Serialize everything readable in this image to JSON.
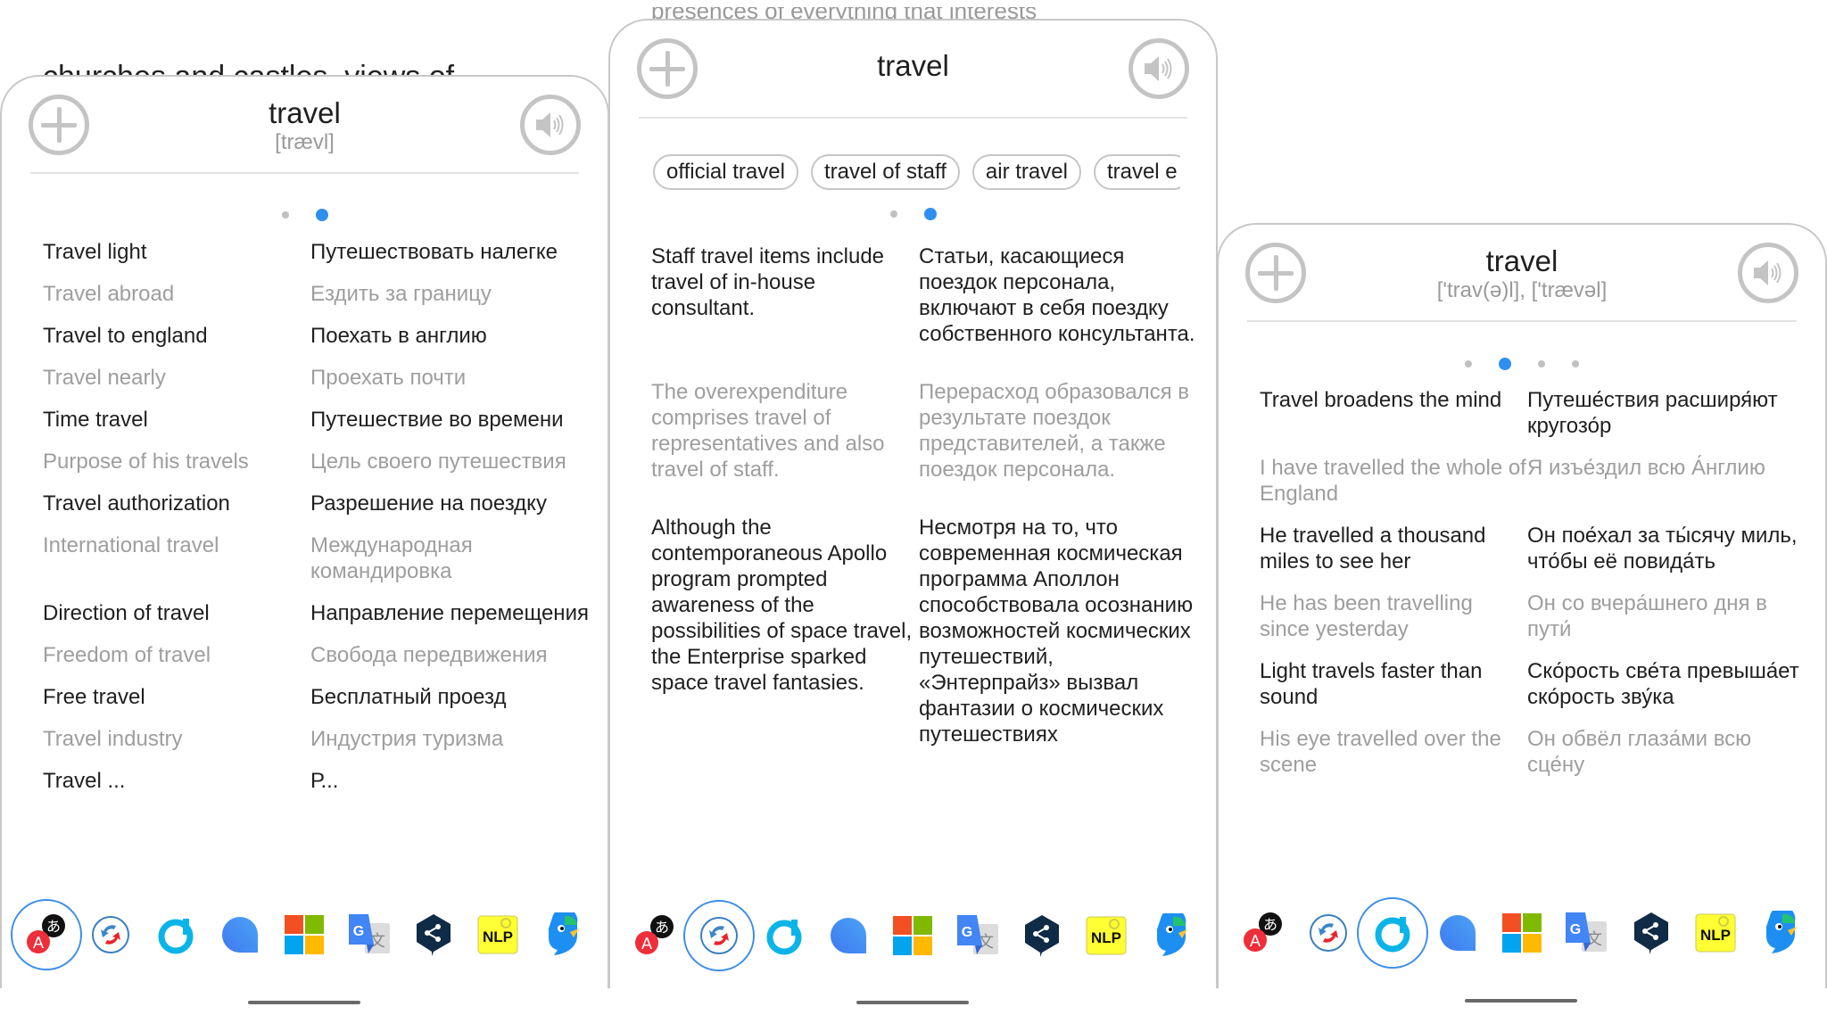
{
  "background_text": {
    "left": "churches and castles, views of",
    "middle": "presences of everything that interests"
  },
  "icons": {
    "add": "plus-circle-icon",
    "sound": "speaker-icon"
  },
  "translator_apps": [
    {
      "name": "translate-a-icon",
      "label": "Translate"
    },
    {
      "name": "reverso-icon",
      "label": "Reverso"
    },
    {
      "name": "dict-d-icon",
      "label": "Dictionary"
    },
    {
      "name": "blue-bubble-icon",
      "label": "Bubble"
    },
    {
      "name": "microsoft-icon",
      "label": "Microsoft Translator"
    },
    {
      "name": "google-translate-icon",
      "label": "Google Translate"
    },
    {
      "name": "deepl-icon",
      "label": "DeepL"
    },
    {
      "name": "nlp-icon",
      "label": "NLP"
    },
    {
      "name": "papago-icon",
      "label": "Papago"
    }
  ],
  "accent_color": "#2f8ff0",
  "panels": [
    {
      "word": "travel",
      "phonetic": "[trævl]",
      "page_count": 2,
      "active_page": 2,
      "selected_app": 1,
      "rows": [
        {
          "en": "Travel light",
          "ru": "Путешествовать налегке",
          "style": "dark"
        },
        {
          "en": "Travel abroad",
          "ru": "Ездить за границу",
          "style": "muted"
        },
        {
          "en": "Travel to england",
          "ru": "Поехать в англию",
          "style": "dark"
        },
        {
          "en": "Travel nearly",
          "ru": "Проехать почти",
          "style": "muted"
        },
        {
          "en": "Time travel",
          "ru": "Путешествие во времени",
          "style": "dark"
        },
        {
          "en": "Purpose of his travels",
          "ru": "Цель своего путешествия",
          "style": "muted"
        },
        {
          "en": "Travel authorization",
          "ru": "Разрешение на поездку",
          "style": "dark"
        },
        {
          "en": "International travel",
          "ru": "Международная командировка",
          "style": "muted"
        },
        {
          "en": "Direction of travel",
          "ru": "Направление перемещения",
          "style": "dark"
        },
        {
          "en": "Freedom of travel",
          "ru": "Свобода передвижения",
          "style": "muted"
        },
        {
          "en": "Free travel",
          "ru": "Бесплатный проезд",
          "style": "dark"
        },
        {
          "en": "Travel industry",
          "ru": "Индустрия туризма",
          "style": "muted"
        },
        {
          "en": "Travel ...",
          "ru": "Р...",
          "style": "dark"
        }
      ]
    },
    {
      "word": "travel",
      "phonetic": "",
      "page_count": 2,
      "active_page": 2,
      "selected_app": 2,
      "chips": [
        "official travel",
        "travel of staff",
        "air travel",
        "travel e"
      ],
      "rows": [
        {
          "en": "Staff travel items include travel of in-house consultant.",
          "ru": "Статьи, касающиеся поездок персонала, включают в себя поездку собственного консультанта.",
          "style": "dark"
        },
        {
          "en": "The overexpenditure comprises travel of representatives and also travel of staff.",
          "ru": "Перерасход образовался в результате поездок представителей, а также поездок персонала.",
          "style": "muted"
        },
        {
          "en": "Although the contemporaneous Apollo program prompted awareness of the possibilities of space travel, the Enterprise sparked space travel fantasies.",
          "ru": "Несмотря на то, что современная космическая программа Аполлон способствовала осознанию возможностей космических путешествий, «Энтерпрайз» вызвал фантазии о космических путешествиях",
          "style": "dark"
        }
      ]
    },
    {
      "word": "travel",
      "phonetic": "['trav(ə)l], ['trævəl]",
      "page_count": 4,
      "active_page": 2,
      "selected_app": 3,
      "rows": [
        {
          "en": "Travel broadens the mind",
          "ru": "Путеше́ствия расширя́ют кругозо́р",
          "style": "dark"
        },
        {
          "en": "I have travelled the whole of England",
          "ru": "Я изъе́здил всю А́нглию",
          "style": "muted"
        },
        {
          "en": "He travelled a thousand miles to see her",
          "ru": "Он пое́хал за ты́сячу миль, что́бы её повида́ть",
          "style": "dark"
        },
        {
          "en": "He has been travelling since yesterday",
          "ru": "Он со вчера́шнего дня в пути́",
          "style": "muted"
        },
        {
          "en": "Light travels faster than sound",
          "ru": "Ско́рость све́та превыша́ет ско́рость зву́ка",
          "style": "dark"
        },
        {
          "en": "His eye travelled over the scene",
          "ru": "Он обвёл глаза́ми всю сце́ну",
          "style": "muted"
        }
      ]
    }
  ]
}
